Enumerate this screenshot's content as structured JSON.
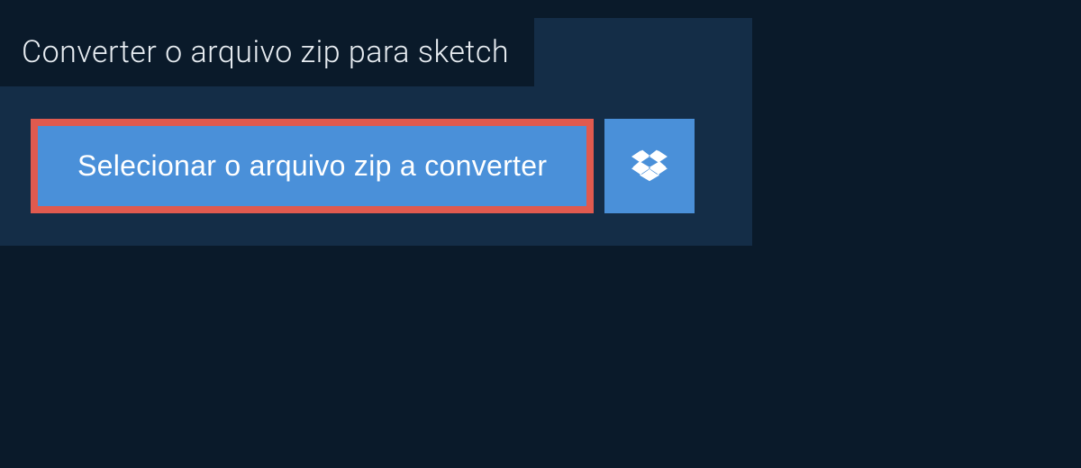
{
  "tab": {
    "title": "Converter o arquivo zip para sketch"
  },
  "actions": {
    "select_file_label": "Selecionar o arquivo zip a converter"
  },
  "colors": {
    "background_dark": "#0a1a2a",
    "panel": "#142d47",
    "button": "#4a90d9",
    "highlight_border": "#e05a4f",
    "text_light": "#e8edf2",
    "text_white": "#ffffff"
  }
}
